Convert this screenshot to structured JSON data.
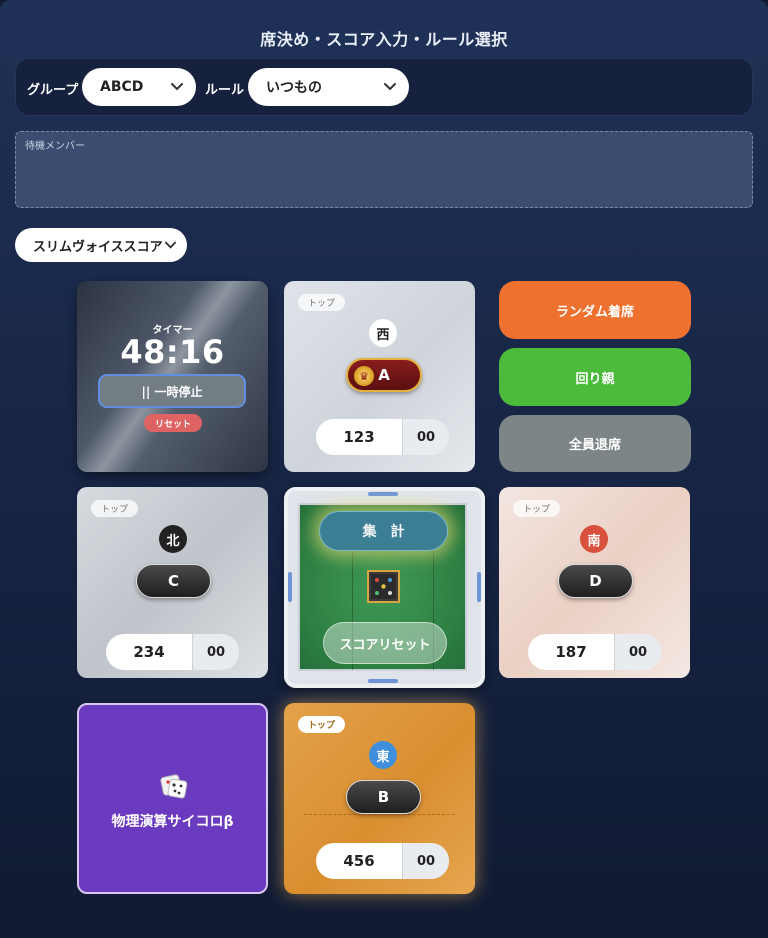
{
  "header": {
    "title": "席決め・スコア入力・ルール選択"
  },
  "filters": {
    "group_label": "グループ",
    "group_value": "ABCD",
    "rule_label": "ルール",
    "rule_value": "いつもの"
  },
  "waiting": {
    "label": "待機メンバー"
  },
  "mode": {
    "value": "スリムヴォイススコア"
  },
  "timer": {
    "label": "タイマー",
    "time": "48:16",
    "pause_label": "|| 一時停止",
    "reset_label": "リセット"
  },
  "seats": {
    "west": {
      "badge": "トップ",
      "wind": "西",
      "player": "A",
      "score": "123",
      "sub": "00"
    },
    "north": {
      "badge": "トップ",
      "wind": "北",
      "player": "C",
      "score": "234",
      "sub": "00"
    },
    "south": {
      "badge": "トップ",
      "wind": "南",
      "player": "D",
      "score": "187",
      "sub": "00"
    },
    "east": {
      "badge": "トップ",
      "wind": "東",
      "player": "B",
      "score": "456",
      "sub": "00"
    }
  },
  "actions": {
    "random_label": "ランダム着席",
    "rotate_label": "回り親",
    "leave_label": "全員退席"
  },
  "table": {
    "tally_label": "集計",
    "score_reset_label": "スコアリセット"
  },
  "dice": {
    "label": "物理演算サイコロβ"
  },
  "colors": {
    "random": "#ef7130",
    "rotate": "#4cbb3c",
    "leave": "#7d8587",
    "dice_tile": "#6a3bbf",
    "west_wind": "#ffffff",
    "north_wind": "#222222",
    "south_wind": "#d9503c",
    "east_wind": "#3f8fdc"
  }
}
